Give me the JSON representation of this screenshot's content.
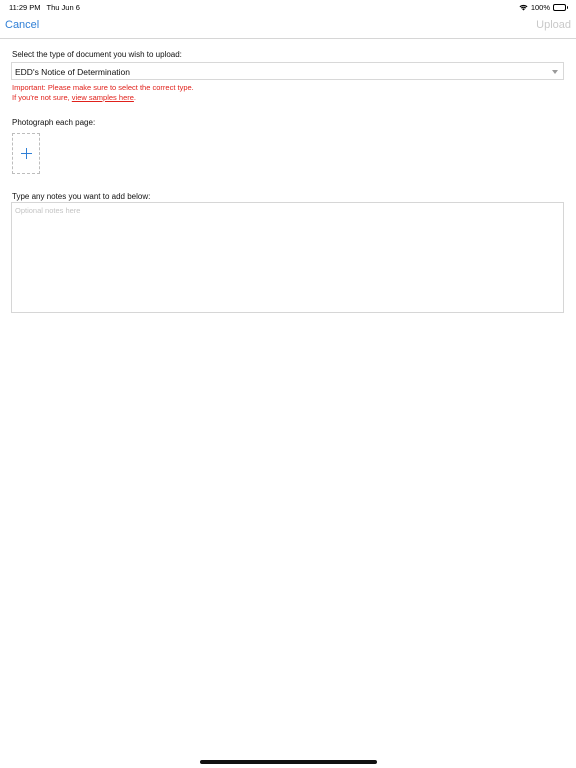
{
  "status_bar": {
    "time": "11:29 PM",
    "date": "Thu Jun 6",
    "battery": "100%"
  },
  "nav": {
    "cancel_label": "Cancel",
    "upload_label": "Upload"
  },
  "form": {
    "doc_type_label": "Select the type of document you wish to upload:",
    "doc_type_value": "EDD's Notice of Determination",
    "warning_line1": "Important: Please make sure to select the correct type.",
    "warning_line2_prefix": "If you're not sure, ",
    "warning_link": "view samples here",
    "warning_line2_suffix": ".",
    "photo_label": "Photograph each page:",
    "notes_label": "Type any notes you want to add below:",
    "notes_placeholder": "Optional notes here",
    "notes_value": ""
  },
  "colors": {
    "accent": "#2f7fd6",
    "warning": "#e0211b",
    "disabled": "#c9c9c9"
  }
}
